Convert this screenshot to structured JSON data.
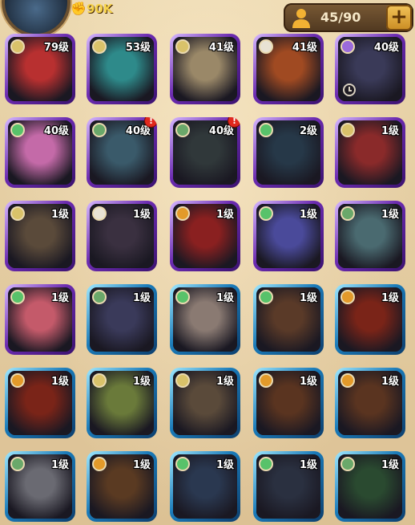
{
  "header": {
    "power_value": "90K",
    "power_icon": "fist-icon",
    "capacity_text": "45/90",
    "capacity_icon": "user-icon",
    "add_label": "+"
  },
  "colors": {
    "lightbearer": "#d9c26a",
    "mauler": "#e39a2a",
    "wilder": "#58c26a",
    "graveborn": "#6aa86a",
    "celestial": "#e8e2d4",
    "hypogean": "#9b6adb"
  },
  "heroes": [
    {
      "level": "79级",
      "faction": "lightbearer",
      "frame": "legendary",
      "portrait": "#b83030"
    },
    {
      "level": "53级",
      "faction": "lightbearer",
      "frame": "legendary",
      "portrait": "#2e8a8a"
    },
    {
      "level": "41级",
      "faction": "lightbearer",
      "frame": "legendary",
      "portrait": "#9a8868"
    },
    {
      "level": "41级",
      "faction": "celestial",
      "frame": "legendary",
      "portrait": "#a04a22"
    },
    {
      "level": "40级",
      "faction": "hypogean",
      "frame": "legendary",
      "portrait": "#3a3a58",
      "clock": true
    },
    {
      "level": "40级",
      "faction": "wilder",
      "frame": "legendary",
      "portrait": "#c46aa8"
    },
    {
      "level": "40级",
      "faction": "graveborn",
      "frame": "legendary",
      "portrait": "#3a5a6a",
      "alert": true
    },
    {
      "level": "40级",
      "faction": "graveborn",
      "frame": "legendary",
      "portrait": "#30383a",
      "alert": true
    },
    {
      "level": "2级",
      "faction": "wilder",
      "frame": "legendary",
      "portrait": "#263848"
    },
    {
      "level": "1级",
      "faction": "lightbearer",
      "frame": "legendary",
      "portrait": "#8a2a2a"
    },
    {
      "level": "1级",
      "faction": "lightbearer",
      "frame": "legendary",
      "portrait": "#5a4a3a"
    },
    {
      "level": "1级",
      "faction": "celestial",
      "frame": "legendary",
      "portrait": "#3a3040"
    },
    {
      "level": "1级",
      "faction": "mauler",
      "frame": "legendary",
      "portrait": "#8a2020"
    },
    {
      "level": "1级",
      "faction": "wilder",
      "frame": "legendary",
      "portrait": "#4a4a9a"
    },
    {
      "level": "1级",
      "faction": "graveborn",
      "frame": "legendary",
      "portrait": "#4a6a70"
    },
    {
      "level": "1级",
      "faction": "wilder",
      "frame": "legendary",
      "portrait": "#c45a6a"
    },
    {
      "level": "1级",
      "faction": "graveborn",
      "frame": "ascended",
      "portrait": "#3a3a5a"
    },
    {
      "level": "1级",
      "faction": "wilder",
      "frame": "ascended",
      "portrait": "#8a7a72"
    },
    {
      "level": "1级",
      "faction": "wilder",
      "frame": "ascended",
      "portrait": "#5a3a28"
    },
    {
      "level": "1级",
      "faction": "mauler",
      "frame": "ascended",
      "portrait": "#7a2418"
    },
    {
      "level": "1级",
      "faction": "mauler",
      "frame": "ascended",
      "portrait": "#7a2418"
    },
    {
      "level": "1级",
      "faction": "lightbearer",
      "frame": "ascended",
      "portrait": "#6a7a3a"
    },
    {
      "level": "1级",
      "faction": "lightbearer",
      "frame": "ascended",
      "portrait": "#5a4a3a"
    },
    {
      "level": "1级",
      "faction": "mauler",
      "frame": "ascended",
      "portrait": "#5a3420"
    },
    {
      "level": "1级",
      "faction": "mauler",
      "frame": "ascended",
      "portrait": "#5a3420"
    },
    {
      "level": "1级",
      "faction": "graveborn",
      "frame": "ascended",
      "portrait": "#6a6a72"
    },
    {
      "level": "1级",
      "faction": "mauler",
      "frame": "ascended",
      "portrait": "#5a3a22"
    },
    {
      "level": "1级",
      "faction": "wilder",
      "frame": "ascended",
      "portrait": "#2a3850"
    },
    {
      "level": "1级",
      "faction": "wilder",
      "frame": "ascended",
      "portrait": "#2a3040"
    },
    {
      "level": "1级",
      "faction": "graveborn",
      "frame": "ascended",
      "portrait": "#2a4a30"
    }
  ]
}
